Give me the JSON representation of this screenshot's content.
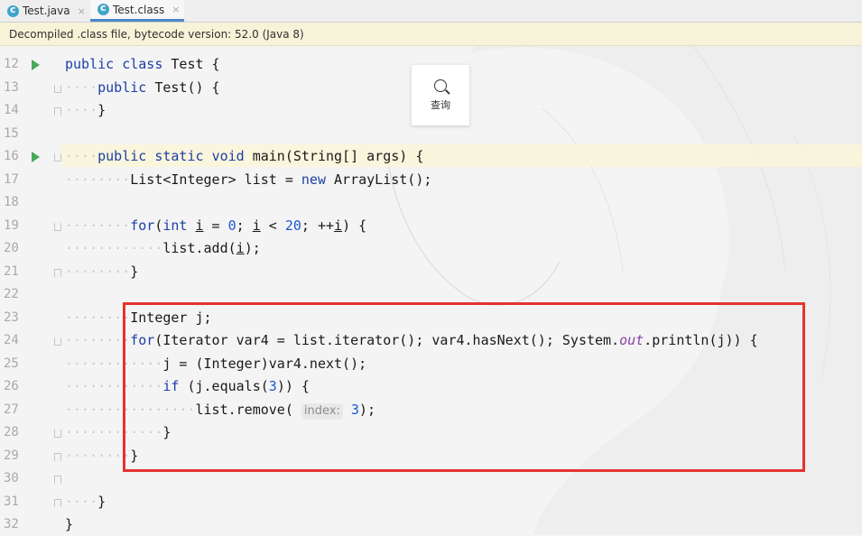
{
  "tabs": [
    {
      "label": "Test.java",
      "close": "×"
    },
    {
      "label": "Test.class",
      "close": "×"
    }
  ],
  "banner": {
    "text": "Decompiled .class file, bytecode version: 52.0 (Java 8)"
  },
  "popup": {
    "label": "查询",
    "icon": "search-icon"
  },
  "line_numbers": [
    "12",
    "13",
    "14",
    "15",
    "16",
    "17",
    "18",
    "19",
    "20",
    "21",
    "22",
    "23",
    "24",
    "25",
    "26",
    "27",
    "28",
    "29",
    "30",
    "31",
    "32"
  ],
  "code": {
    "l12": {
      "public": "public",
      "class": "class",
      "name": " Test {"
    },
    "l13": {
      "public": "public",
      "rest": " Test() {"
    },
    "l14": {
      "text": "}"
    },
    "l16": {
      "public": "public",
      "static": "static",
      "void": "void",
      "rest": " main(String[] args) {"
    },
    "l17": {
      "a": "List<Integer> list = ",
      "new": "new",
      "b": " ArrayList();"
    },
    "l19": {
      "for": "for",
      "a": "(",
      "int": "int",
      "b": " ",
      "i1": "i",
      "c": " = ",
      "n0": "0",
      "d": "; ",
      "i2": "i",
      "e": " < ",
      "n20": "20",
      "f": "; ++",
      "i3": "i",
      "g": ") {"
    },
    "l20": {
      "a": "list.add(",
      "i": "i",
      "b": ");"
    },
    "l21": {
      "text": "}"
    },
    "l23": {
      "text": "Integer j;"
    },
    "l24": {
      "for": "for",
      "a": "(Iterator var4 = list.iterator(); var4.hasNext(); System.",
      "out": "out",
      "b": ".println(j)) {"
    },
    "l25": {
      "text": "j = (Integer)var4.next();"
    },
    "l26": {
      "if": "if",
      "a": " (j.equals(",
      "n": "3",
      "b": ")) {"
    },
    "l27": {
      "a": "list.remove( ",
      "hint": "index:",
      "n": "3",
      "b": ");"
    },
    "l28": {
      "text": "}"
    },
    "l29": {
      "text": "}"
    },
    "l31": {
      "text": "}"
    },
    "l32": {
      "text": "}"
    }
  },
  "colors": {
    "keyword": "#1c3fa6",
    "number": "#1c58d0",
    "field": "#8a3ea8",
    "annotation_box": "#e5332e",
    "run_icon": "#48a85a"
  }
}
